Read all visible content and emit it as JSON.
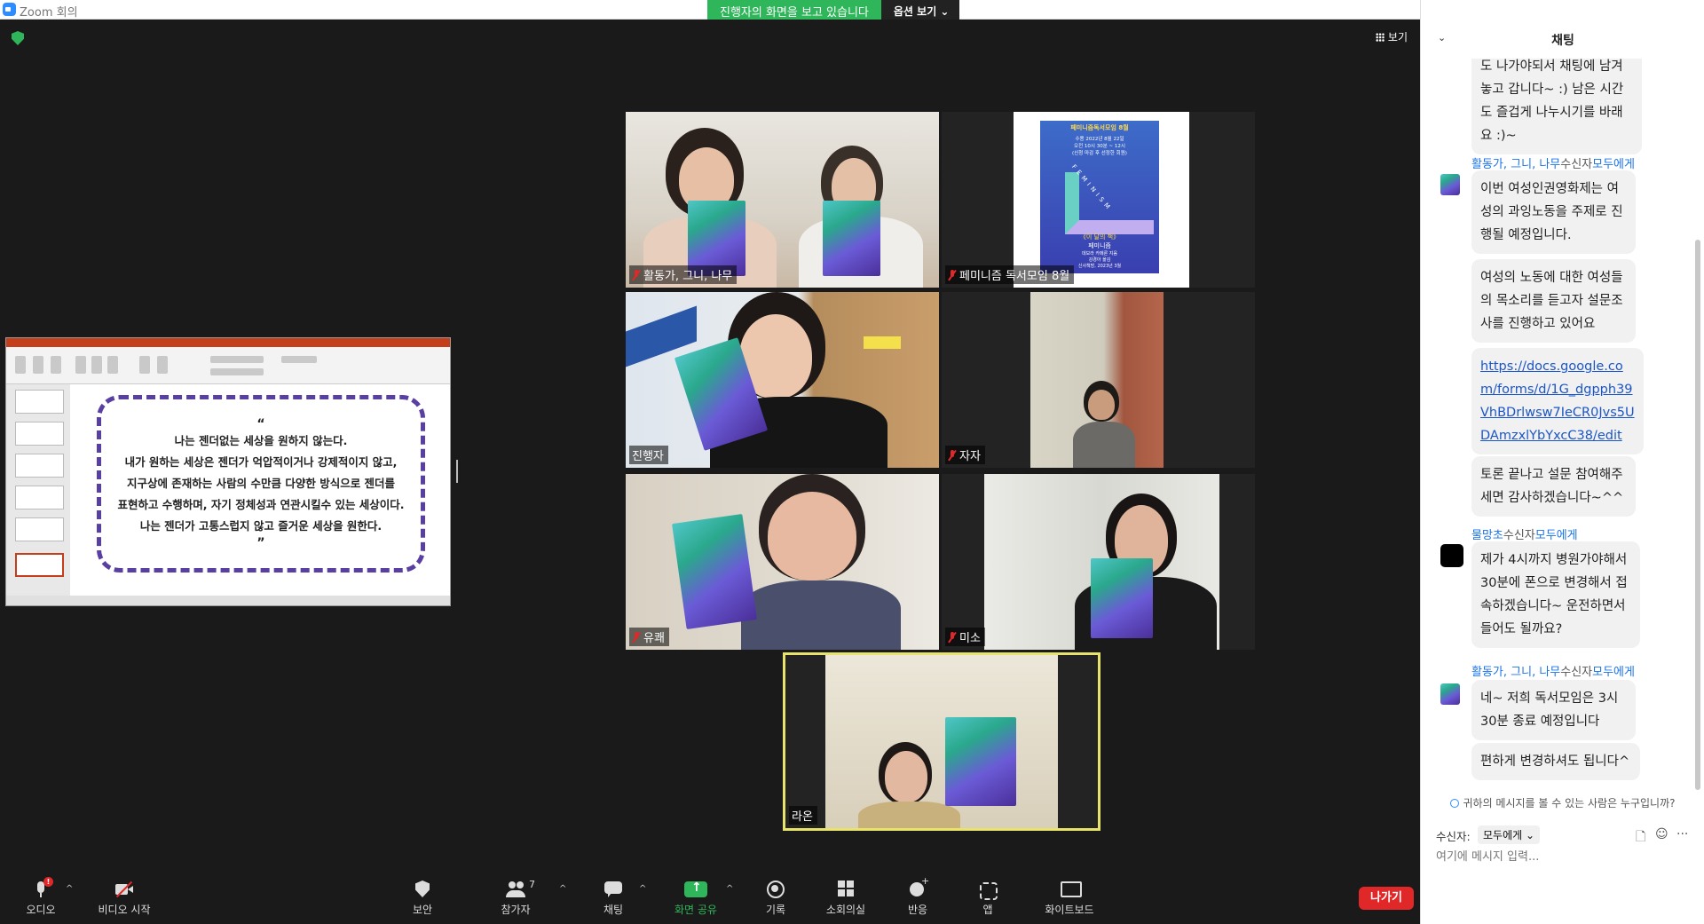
{
  "titlebar": {
    "title": "Zoom 회의"
  },
  "banner": {
    "sharing_text": "진행자의 화면을 보고 있습니다",
    "options_label": "옵션 보기 ⌄"
  },
  "window_controls": {
    "minimize": "—",
    "restore": "❐",
    "close": "✕"
  },
  "view_button": {
    "label": "보기"
  },
  "slide": {
    "quote_open": "“",
    "lines": [
      "나는 젠더없는 세상을 원하지 않는다.",
      "내가 원하는 세상은 젠더가 억압적이거나 강제적이지 않고,",
      "지구상에 존재하는 사람의 수만큼 다양한 방식으로 젠더를",
      "표현하고 수행하며, 자기 정체성과 연관시킬수 있는 세상이다.",
      "나는 젠더가 고통스럽지 않고 즐거운 세상을 원한다."
    ],
    "quote_close": "”"
  },
  "tiles": [
    {
      "name": "활동가, 그니, 나무"
    },
    {
      "name": "페미니즘 독서모임 8월"
    },
    {
      "name": "진행자"
    },
    {
      "name": "자자"
    },
    {
      "name": "유쾌"
    },
    {
      "name": "미소"
    },
    {
      "name": "라온"
    }
  ],
  "poster": {
    "header": "페미니즘독서모임 8월",
    "lines": [
      "수용 2022년 8월 22일",
      "오전 10시 30분 ~ 12시",
      "(신청 마감 후 선정한 회원)"
    ],
    "vertical": "FEMINISM",
    "book_title": "《이 달의 책》",
    "book_name": "페미니즘",
    "footer": [
      "데보라 카메론 지음",
      "강경아 옮김",
      "신사책방, 2023년 3월"
    ]
  },
  "toolbar": {
    "audio": "오디오",
    "audio_badge": "!",
    "video": "비디오 시작",
    "security": "보안",
    "participants": "참가자",
    "participant_count": "7",
    "chat": "채팅",
    "share": "화면 공유",
    "record": "기록",
    "rooms": "소회의실",
    "reactions": "반응",
    "apps": "앱",
    "whiteboard": "화이트보드",
    "leave": "나가기",
    "caret": "^"
  },
  "chat": {
    "title": "채팅",
    "collapse_icon": "⌄",
    "messages": [
      {
        "type": "continuation",
        "text": "도 나가야되서 채팅에 남겨 놓고 갑니다~ :) 남은 시간도 즐겁게 나누시기를 바래요 :)~"
      },
      {
        "type": "header",
        "sender": "활동가, 그니, 나무",
        "to_prefix": "수신자",
        "to": "모두에게"
      },
      {
        "type": "text",
        "text": "이번 여성인권영화제는 여성의 과잉노동을 주제로 진행될 예정입니다."
      },
      {
        "type": "text",
        "text": "여성의 노동에 대한 여성들의 목소리를 듣고자 설문조사를 진행하고 있어요"
      },
      {
        "type": "link",
        "text": "https://docs.google.com/forms/d/1G_dgpph39VhBDrlwsw7IeCR0Jvs5UDAmzxlYbYxcC38/edit"
      },
      {
        "type": "text",
        "text": "토론 끝나고 설문 참여해주세면 감사하겠습니다~^^"
      },
      {
        "type": "header",
        "sender": "물망초",
        "to_prefix": "수신자",
        "to": "모두에게"
      },
      {
        "type": "text",
        "text": "제가 4시까지 병원가야해서 30분에 폰으로 변경해서 접속하겠습니다~ 운전하면서 들어도 될까요?"
      },
      {
        "type": "header",
        "sender": "활동가, 그니, 나무",
        "to_prefix": "수신자",
        "to": "모두에게"
      },
      {
        "type": "text",
        "text": "네~ 저희 독서모임은 3시 30분 종료 예정입니다"
      },
      {
        "type": "text",
        "text": "편하게 변경하셔도 됩니다^"
      }
    ],
    "who_can_see": "귀하의 메시지를 볼 수 있는 사람은 누구입니까?",
    "recipient_label": "수신자:",
    "recipient_value": "모두에게 ⌄",
    "file_icon": "🗋",
    "emoji_icon": "☺",
    "more_icon": "···",
    "input_placeholder": "여기에 메시지 입력..."
  }
}
